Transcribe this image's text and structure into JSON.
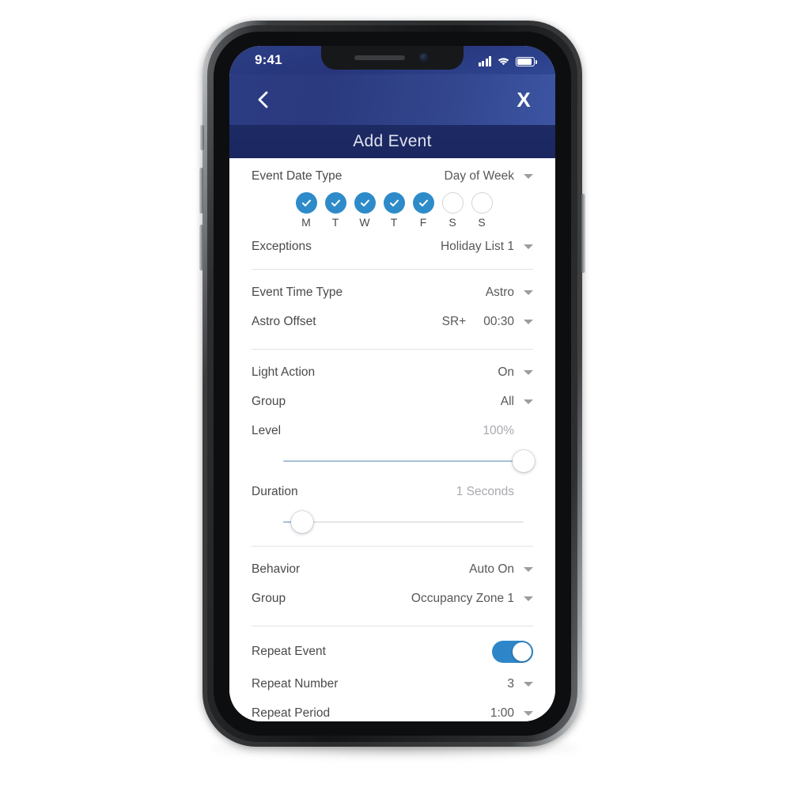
{
  "status_bar": {
    "time": "9:41",
    "icons": [
      "signal-icon",
      "wifi-icon",
      "battery-icon"
    ]
  },
  "nav": {
    "back_icon": "chevron-left-icon",
    "close_label": "X",
    "title": "Add Event"
  },
  "form": {
    "sections": [
      {
        "name": "date",
        "rows": [
          {
            "label": "Event Date Type",
            "value": "Day of Week",
            "caret": true
          }
        ],
        "days": {
          "items": [
            {
              "letter": "M",
              "selected": true
            },
            {
              "letter": "T",
              "selected": true
            },
            {
              "letter": "W",
              "selected": true
            },
            {
              "letter": "T",
              "selected": true
            },
            {
              "letter": "F",
              "selected": true
            },
            {
              "letter": "S",
              "selected": false
            },
            {
              "letter": "S",
              "selected": false
            }
          ]
        },
        "rows2": [
          {
            "label": "Exceptions",
            "value": "Holiday List 1",
            "caret": true
          }
        ]
      },
      {
        "name": "time",
        "rows": [
          {
            "label": "Event Time Type",
            "value": "Astro",
            "caret": true
          },
          {
            "label": "Astro Offset",
            "prefix": "SR+",
            "value": "00:30",
            "caret": true
          }
        ]
      },
      {
        "name": "light",
        "rows": [
          {
            "label": "Light Action",
            "value": "On",
            "caret": true
          },
          {
            "label": "Group",
            "value": "All",
            "caret": true
          },
          {
            "label": "Level",
            "value": "100%",
            "caret": false,
            "muted": true
          }
        ],
        "level_slider": {
          "percent": 100
        },
        "duration_row": {
          "label": "Duration",
          "value": "1 Seconds",
          "muted": true
        },
        "duration_slider": {
          "percent": 8
        }
      },
      {
        "name": "behavior",
        "rows": [
          {
            "label": "Behavior",
            "value": "Auto On",
            "caret": true
          },
          {
            "label": "Group",
            "value": "Occupancy Zone 1",
            "caret": true
          }
        ]
      },
      {
        "name": "repeat",
        "toggle_row": {
          "label": "Repeat Event",
          "on": true
        },
        "rows": [
          {
            "label": "Repeat Number",
            "value": "3",
            "caret": true
          },
          {
            "label": "Repeat Period",
            "value": "1:00",
            "caret": true
          }
        ]
      }
    ]
  },
  "colors": {
    "accent_blue": "#2e8bc9",
    "toggle_blue": "#2e86c8",
    "header_navy": "#1d2a63",
    "navbar_blue": "#2c3c83",
    "label_gray": "#4a4a4c",
    "muted_gray": "#a7a9ae"
  }
}
